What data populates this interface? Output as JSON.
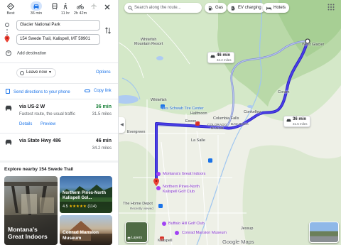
{
  "travel_modes": [
    {
      "label": "Best",
      "icon": "directions-diamond-icon",
      "active": false
    },
    {
      "label": "36 min",
      "icon": "car-icon",
      "active": true
    },
    {
      "label": "",
      "icon": "transit-icon",
      "active": false
    },
    {
      "label": "11 hr",
      "icon": "walk-icon",
      "active": false
    },
    {
      "label": "2h 42m",
      "icon": "bike-icon",
      "active": false
    },
    {
      "label": "",
      "icon": "flight-icon",
      "active": false
    }
  ],
  "origin": {
    "value": "Glacier National Park"
  },
  "destination": {
    "value": "154 Swede Trail, Kalispell, MT 59901"
  },
  "add_destination": "Add destination",
  "leave_now": "Leave now",
  "options": "Options",
  "send_to_phone": "Send directions to your phone",
  "copy_link": "Copy link",
  "routes": [
    {
      "name": "via US-2 W",
      "time": "36 min",
      "description": "Fastest route, the usual traffic",
      "distance": "31.5 miles",
      "details": "Details",
      "preview": "Preview"
    },
    {
      "name": "via State Hwy 486",
      "time": "46 min",
      "distance": "34.2 miles"
    }
  ],
  "explore": {
    "title": "Explore nearby 154 Swede Trail",
    "cards": [
      {
        "title": "Montana's Great Indoors"
      },
      {
        "title": "Northern Pines-North Kalispell Gol...",
        "rating": "4.5",
        "stars": "★★★★★",
        "reviews": "(114)"
      },
      {
        "title": "Conrad Mansion Museum"
      }
    ]
  },
  "map": {
    "search_placeholder": "Search along the route...",
    "chips": [
      "Gas",
      "EV charging",
      "Hotels"
    ],
    "callout_fast": {
      "time": "36 min",
      "distance": "31.5 miles"
    },
    "callout_alt": {
      "time": "46 min",
      "distance": "34.2 miles"
    },
    "labels": {
      "whitefish_mtn": "Whitefish\nMountain Resort",
      "whitefish": "Whitefish",
      "west_glacier": "West Glacier",
      "coram": "Coram",
      "les_schwab": "Les Schwab Tire Center",
      "halfmoon": "Halfmoon",
      "columbia_falls": "Columbia Falls",
      "conkelley": "Conkelley",
      "evergreen": "Evergreen",
      "bad_rock": "BAD ROCK",
      "colorado_manor": "COLORADO\nMANOR",
      "exxon": "Exxon",
      "la_salle": "La Salle",
      "montanas_great_indoors": "Montana's Great Indoors",
      "northern_pines": "Northern Pines-North\nKalispell Golf Club",
      "home_depot": "The Home Depot",
      "home_depot_sub": "Recently viewed",
      "buffalo_hill": "Buffalo Hill Golf Club",
      "conrad_mansion": "Conrad Mansion Museum",
      "kalispell": "Kalispell",
      "jessup": "Jessup",
      "layers": "Layers",
      "google_maps": "Google Maps"
    }
  },
  "colors": {
    "route_primary": "#3c2fd6",
    "route_alt": "#8a9be0",
    "accent_blue": "#1a73e8",
    "fast_green": "#188038"
  }
}
